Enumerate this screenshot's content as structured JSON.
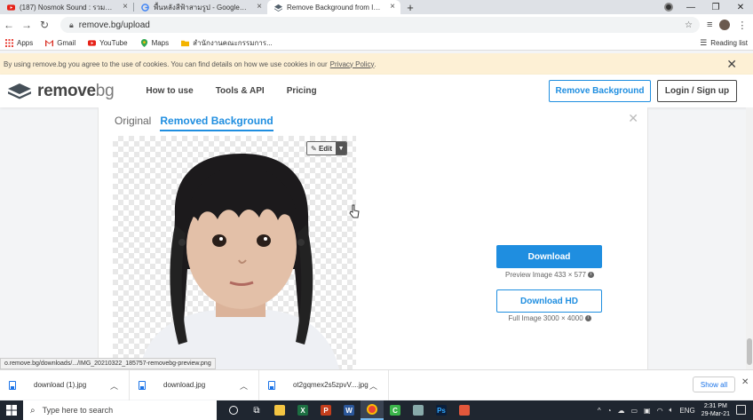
{
  "browser": {
    "tabs": [
      {
        "label": "(187) Nosmok Sound : รวมเพลง C",
        "favicon": "youtube-icon"
      },
      {
        "label": "พื้นหลังสีฟ้าสามรูป - Google Search",
        "favicon": "google-icon"
      },
      {
        "label": "Remove Background from Image",
        "favicon": "removebg-icon",
        "active": true
      }
    ],
    "url": "remove.bg/upload",
    "bookmarks": [
      {
        "label": "Apps",
        "icon": "apps-grid-icon"
      },
      {
        "label": "Gmail",
        "icon": "gmail-icon"
      },
      {
        "label": "YouTube",
        "icon": "youtube-icon"
      },
      {
        "label": "Maps",
        "icon": "maps-icon"
      },
      {
        "label": "สำนักงานคณะกรรมการ...",
        "icon": "folder-icon"
      }
    ],
    "reading_list": "Reading list"
  },
  "cookie": {
    "text": "By using remove.bg you agree to the use of cookies. You can find details on how we use cookies in our",
    "link": "Privacy Policy",
    "suffix": "."
  },
  "site": {
    "logo_main": "remove",
    "logo_accent": "bg",
    "nav": [
      "How to use",
      "Tools & API",
      "Pricing"
    ],
    "cta": "Remove Background",
    "login": "Login / Sign up"
  },
  "editor": {
    "tab_original": "Original",
    "tab_removed": "Removed Background",
    "edit_label": "Edit",
    "download_label": "Download",
    "preview_info": "Preview Image 433 × 577",
    "download_hd_label": "Download HD",
    "full_info": "Full Image 3000 × 4000"
  },
  "status_url": "o.remove.bg/downloads/.../IMG_20210322_185757-removebg-preview.png",
  "downloads": {
    "items": [
      "download (1).jpg",
      "download.jpg",
      "ot2gqmex2s5zpvV....jpg"
    ],
    "show_all": "Show all"
  },
  "taskbar": {
    "search_placeholder": "Type here to search",
    "language": "ENG",
    "time": "2:31 PM",
    "date": "29-Mar-21"
  },
  "colors": {
    "accent": "#1f8ee0",
    "cookie_bg": "#fdf0d5",
    "taskbar": "#1f2630"
  }
}
